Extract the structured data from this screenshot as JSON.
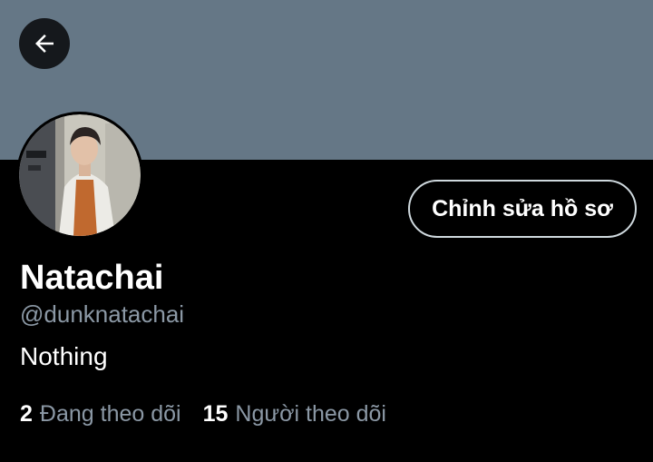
{
  "profile": {
    "display_name": "Natachai",
    "handle": "@dunknatachai",
    "bio": "Nothing",
    "edit_button_label": "Chỉnh sửa hồ sơ"
  },
  "stats": {
    "following_count": "2",
    "following_label": "Đang theo dõi",
    "followers_count": "15",
    "followers_label": "Người theo dõi"
  },
  "icons": {
    "back": "arrow-left-icon",
    "avatar": "profile-photo"
  },
  "colors": {
    "banner": "#657786",
    "background": "#000000",
    "secondary_text": "#8b98a5",
    "primary_text": "#ffffff",
    "button_border": "#cfd9de"
  }
}
